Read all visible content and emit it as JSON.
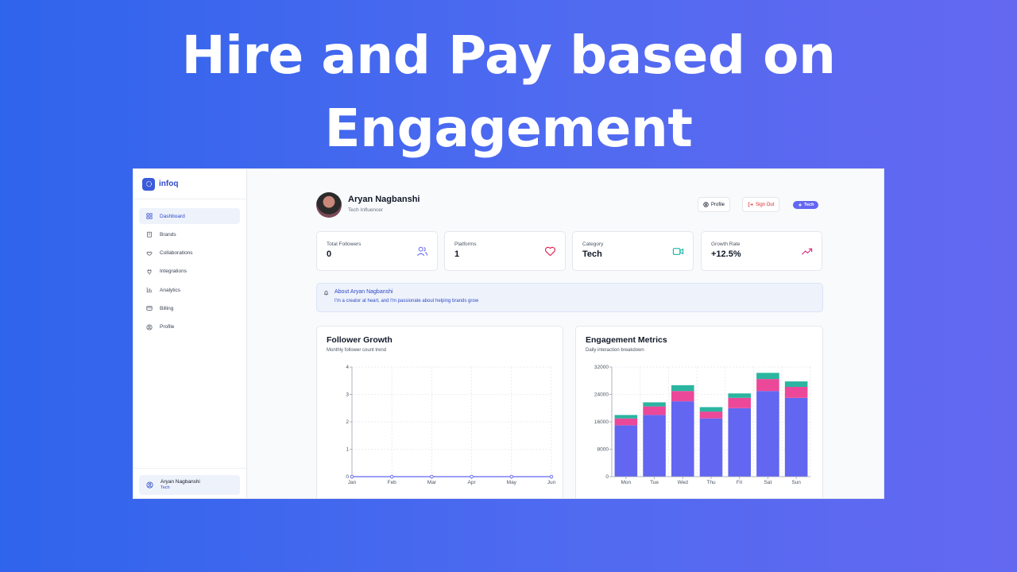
{
  "headline": {
    "line1": "Hire and Pay based on",
    "line2": "Engagement"
  },
  "app": {
    "brand": "infoq",
    "sidebar": {
      "items": [
        {
          "label": "Dashboard",
          "icon": "grid-icon"
        },
        {
          "label": "Brands",
          "icon": "building-icon"
        },
        {
          "label": "Collaborations",
          "icon": "handshake-icon"
        },
        {
          "label": "Integrations",
          "icon": "plug-icon"
        },
        {
          "label": "Analytics",
          "icon": "bar-chart-icon"
        },
        {
          "label": "Billing",
          "icon": "credit-card-icon"
        },
        {
          "label": "Profile",
          "icon": "user-circle-icon"
        }
      ],
      "footer": {
        "name": "Aryan Nagbanshi",
        "role": "Tech"
      }
    },
    "header": {
      "name": "Aryan Nagbanshi",
      "role": "Tech Influencer",
      "profile_label": "Profile",
      "signout_label": "Sign Out",
      "badge": "Tech"
    },
    "stats": [
      {
        "label": "Total Followers",
        "value": "0",
        "icon": "users-icon",
        "color": "#6366f1"
      },
      {
        "label": "Platforms",
        "value": "1",
        "icon": "heart-icon",
        "color": "#e11d48"
      },
      {
        "label": "Category",
        "value": "Tech",
        "icon": "video-icon",
        "color": "#14b8a6"
      },
      {
        "label": "Growth Rate",
        "value": "+12.5%",
        "icon": "trending-up-icon",
        "color": "#db2777"
      }
    ],
    "about": {
      "title": "About Aryan Nagbanshi",
      "text": "I'm a creator at heart, and I'm passionate about helping brands grow"
    },
    "follower_card": {
      "title": "Follower Growth",
      "subtitle": "Monthly follower count trend"
    },
    "engagement_card": {
      "title": "Engagement Metrics",
      "subtitle": "Daily interaction breakdown"
    }
  },
  "colors": {
    "accent": "#2f4ac7",
    "series_blue": "#6366f1",
    "series_pink": "#ec4899",
    "series_teal": "#2bb5a0"
  },
  "chart_data": [
    {
      "type": "line",
      "title": "Follower Growth",
      "categories": [
        "Jan",
        "Feb",
        "Mar",
        "Apr",
        "May",
        "Jun"
      ],
      "values": [
        0,
        0,
        0,
        0,
        0,
        0
      ],
      "yticks": [
        0,
        1,
        2,
        3,
        4
      ],
      "ylim": [
        0,
        4
      ],
      "grid": true
    },
    {
      "type": "bar",
      "stacked": true,
      "title": "Engagement Metrics",
      "categories": [
        "Mon",
        "Tue",
        "Wed",
        "Thu",
        "Fri",
        "Sat",
        "Sun"
      ],
      "series": [
        {
          "values": [
            15000,
            18000,
            22000,
            17000,
            20000,
            25000,
            23000
          ],
          "color": "#6366f1"
        },
        {
          "values": [
            2000,
            2500,
            3000,
            2000,
            3000,
            3500,
            3200
          ],
          "color": "#ec4899"
        },
        {
          "values": [
            1000,
            1200,
            1700,
            1300,
            1300,
            1800,
            1600
          ],
          "color": "#2bb5a0"
        }
      ],
      "yticks": [
        0,
        8000,
        16000,
        24000,
        32000
      ],
      "ylim": [
        0,
        32000
      ],
      "grid": true
    }
  ]
}
